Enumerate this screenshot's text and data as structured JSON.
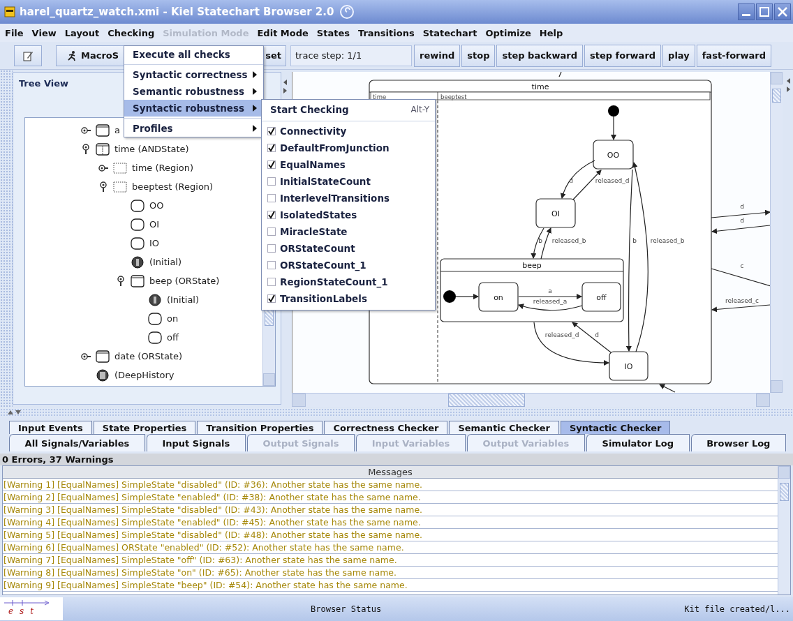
{
  "window": {
    "title": "harel_quartz_watch.xmi - Kiel Statechart Browser 2.0"
  },
  "menu_bar": [
    {
      "label": "File",
      "disabled": false
    },
    {
      "label": "View",
      "disabled": false
    },
    {
      "label": "Layout",
      "disabled": false
    },
    {
      "label": "Checking",
      "disabled": false
    },
    {
      "label": "Simulation Mode",
      "disabled": true
    },
    {
      "label": "Edit Mode",
      "disabled": false
    },
    {
      "label": "States",
      "disabled": false
    },
    {
      "label": "Transitions",
      "disabled": false
    },
    {
      "label": "Statechart",
      "disabled": false
    },
    {
      "label": "Optimize",
      "disabled": false
    },
    {
      "label": "Help",
      "disabled": false
    }
  ],
  "toolbar": {
    "left_buttons": [
      {
        "kind": "pencil"
      },
      {
        "kind": "runner",
        "label": "MacroS"
      },
      {
        "kind": "text",
        "label": "set"
      }
    ],
    "trace_step": "trace step: 1/1",
    "buttons": [
      "rewind",
      "stop",
      "step backward",
      "step forward",
      "play",
      "fast-forward"
    ]
  },
  "tree_view": {
    "title": "Tree View",
    "items": [
      {
        "label": "a",
        "kind": "or_state",
        "expanded": false
      },
      {
        "label": "time (ANDState)",
        "kind": "and_state",
        "expanded": true,
        "children": [
          {
            "label": "time (Region)",
            "kind": "region",
            "expanded": false
          },
          {
            "label": "beeptest (Region)",
            "kind": "region",
            "expanded": true,
            "children": [
              {
                "label": "OO",
                "kind": "simple_state"
              },
              {
                "label": "OI",
                "kind": "simple_state"
              },
              {
                "label": "IO",
                "kind": "simple_state"
              },
              {
                "label": "(Initial)",
                "kind": "initial"
              },
              {
                "label": "beep (ORState)",
                "kind": "or_state",
                "expanded": true,
                "children": [
                  {
                    "label": "(Initial)",
                    "kind": "initial"
                  },
                  {
                    "label": "on",
                    "kind": "simple_state"
                  },
                  {
                    "label": "off",
                    "kind": "simple_state"
                  }
                ]
              }
            ]
          }
        ]
      },
      {
        "label": "date (ORState)",
        "kind": "or_state",
        "expanded": false
      },
      {
        "label": "(DeepHistory",
        "kind": "history"
      }
    ]
  },
  "diagram": {
    "outer_state": "time",
    "regions": [
      "time",
      "beeptest"
    ],
    "inner_state": "beep",
    "states": [
      "OO",
      "OI",
      "IO",
      "on",
      "off"
    ],
    "transitions": [
      "d",
      "released_d",
      "b",
      "released_b",
      "b",
      "released_b",
      "a",
      "released_a",
      "released_d",
      "d",
      "d",
      "d",
      "c",
      "released_c"
    ]
  },
  "checking_menu": [
    {
      "kind": "command",
      "label": "Execute all checks",
      "selected": false
    },
    {
      "kind": "separator"
    },
    {
      "kind": "submenu",
      "label": "Syntactic correctness",
      "selected": false
    },
    {
      "kind": "submenu",
      "label": "Semantic robustness",
      "selected": false
    },
    {
      "kind": "submenu",
      "label": "Syntactic robustness",
      "selected": true
    },
    {
      "kind": "separator"
    },
    {
      "kind": "submenu",
      "label": "Profiles",
      "selected": false
    }
  ],
  "robustness_submenu": {
    "command": {
      "label": "Start Checking",
      "shortcut": "Alt-Y"
    },
    "checks": [
      {
        "label": "Connectivity",
        "checked": true
      },
      {
        "label": "DefaultFromJunction",
        "checked": true
      },
      {
        "label": "EqualNames",
        "checked": true
      },
      {
        "label": "InitialStateCount",
        "checked": false
      },
      {
        "label": "InterlevelTransitions",
        "checked": false
      },
      {
        "label": "IsolatedStates",
        "checked": true
      },
      {
        "label": "MiracleState",
        "checked": false
      },
      {
        "label": "ORStateCount",
        "checked": false
      },
      {
        "label": "ORStateCount_1",
        "checked": false
      },
      {
        "label": "RegionStateCount_1",
        "checked": false
      },
      {
        "label": "TransitionLabels",
        "checked": true
      }
    ]
  },
  "bottom_tabs": {
    "row_1": [
      {
        "label": "Input Events",
        "selected": false,
        "disabled": false
      },
      {
        "label": "State Properties",
        "selected": false,
        "disabled": false
      },
      {
        "label": "Transition Properties",
        "selected": false,
        "disabled": false
      },
      {
        "label": "Correctness Checker",
        "selected": false,
        "disabled": false
      },
      {
        "label": "Semantic Checker",
        "selected": false,
        "disabled": false
      },
      {
        "label": "Syntactic Checker",
        "selected": true,
        "disabled": false
      }
    ],
    "row_2": [
      {
        "label": "All Signals/Variables",
        "selected": false,
        "disabled": false
      },
      {
        "label": "Input Signals",
        "selected": false,
        "disabled": false
      },
      {
        "label": "Output Signals",
        "selected": false,
        "disabled": true
      },
      {
        "label": "Input Variables",
        "selected": false,
        "disabled": true
      },
      {
        "label": "Output Variables",
        "selected": false,
        "disabled": true
      },
      {
        "label": "Simulator Log",
        "selected": false,
        "disabled": false
      },
      {
        "label": "Browser Log",
        "selected": false,
        "disabled": false
      }
    ]
  },
  "messages": {
    "summary": "0 Errors, 37 Warnings",
    "column": "Messages",
    "rows": [
      {
        "kind": "warning",
        "text": "[Warning 1] [EqualNames] SimpleState \"disabled\" (ID: #36): Another state has the same name."
      },
      {
        "kind": "warning",
        "text": "[Warning 2] [EqualNames] SimpleState \"enabled\" (ID: #38): Another state has the same name."
      },
      {
        "kind": "warning",
        "text": "[Warning 3] [EqualNames] SimpleState \"disabled\" (ID: #43): Another state has the same name."
      },
      {
        "kind": "warning",
        "text": "[Warning 4] [EqualNames] SimpleState \"enabled\" (ID: #45): Another state has the same name."
      },
      {
        "kind": "warning",
        "text": "[Warning 5] [EqualNames] SimpleState \"disabled\" (ID: #48): Another state has the same name."
      },
      {
        "kind": "warning",
        "text": "[Warning 6] [EqualNames] ORState \"enabled\" (ID: #52): Another state has the same name."
      },
      {
        "kind": "warning",
        "text": "[Warning 7] [EqualNames] SimpleState \"off\" (ID: #63): Another state has the same name."
      },
      {
        "kind": "warning",
        "text": "[Warning 8] [EqualNames] SimpleState \"on\" (ID: #65): Another state has the same name."
      },
      {
        "kind": "warning",
        "text": "[Warning 9] [EqualNames] SimpleState \"beep\" (ID: #54): Another state has the same name."
      }
    ]
  },
  "status_bar": {
    "logo_letters": [
      "e",
      "s",
      "t"
    ],
    "center": "Browser Status",
    "right": "Kit file created/l..."
  }
}
